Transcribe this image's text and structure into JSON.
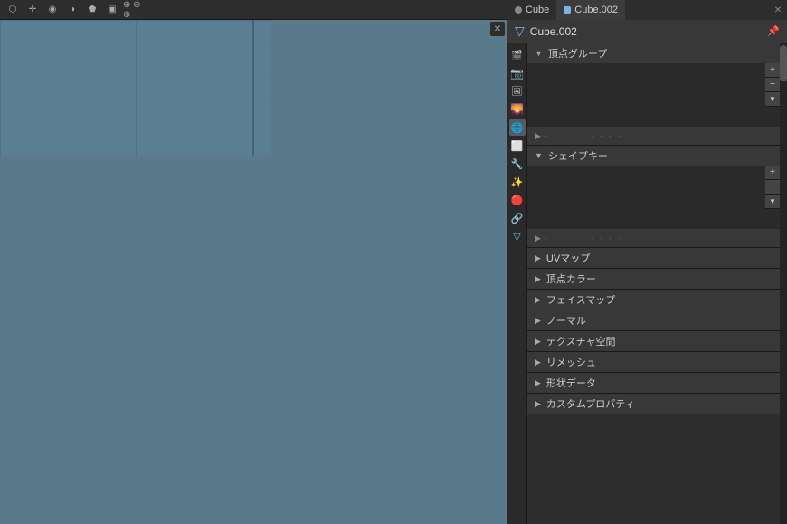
{
  "topbar": {
    "title": "Cube",
    "title2": "Cube.002",
    "object_name": "Cube.002"
  },
  "viewport": {
    "bg_color": "#5b7f92"
  },
  "properties": {
    "header_name": "Cube.002",
    "sections": [
      {
        "id": "vertex-group",
        "label": "頂点グループ",
        "expanded": true
      },
      {
        "id": "shape-key",
        "label": "シェイプキー",
        "expanded": true
      },
      {
        "id": "uv-map",
        "label": "UVマップ",
        "expanded": false
      },
      {
        "id": "vertex-color",
        "label": "頂点カラー",
        "expanded": false
      },
      {
        "id": "face-map",
        "label": "フェイスマップ",
        "expanded": false
      },
      {
        "id": "normal",
        "label": "ノーマル",
        "expanded": false
      },
      {
        "id": "texture-space",
        "label": "テクスチャ空間",
        "expanded": false
      },
      {
        "id": "remesh",
        "label": "リメッシュ",
        "expanded": false
      },
      {
        "id": "shape-data",
        "label": "形状データ",
        "expanded": false
      },
      {
        "id": "custom-prop",
        "label": "カスタムプロパティ",
        "expanded": false
      }
    ]
  },
  "sidebar": {
    "icons": [
      {
        "id": "render",
        "symbol": "🎬",
        "active": false
      },
      {
        "id": "output",
        "symbol": "📤",
        "active": false
      },
      {
        "id": "view",
        "symbol": "👁",
        "active": false
      },
      {
        "id": "scene",
        "symbol": "🌄",
        "active": false
      },
      {
        "id": "world",
        "symbol": "🌐",
        "active": true
      },
      {
        "id": "object",
        "symbol": "⬜",
        "active": false
      },
      {
        "id": "modifier",
        "symbol": "🔧",
        "active": false
      },
      {
        "id": "particles",
        "symbol": "✨",
        "active": false
      },
      {
        "id": "physics",
        "symbol": "🔵",
        "active": false
      },
      {
        "id": "constraints",
        "symbol": "🔗",
        "active": false
      },
      {
        "id": "data",
        "symbol": "▲",
        "active": false
      }
    ]
  },
  "buttons": {
    "add": "+",
    "remove": "−",
    "more": "≡"
  }
}
